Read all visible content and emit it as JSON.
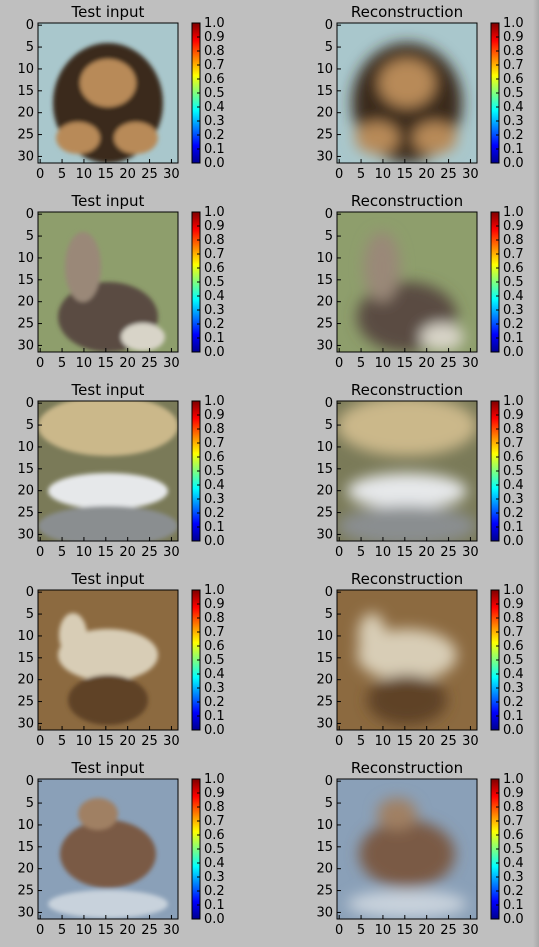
{
  "chart_data": [
    {
      "type": "heatmap",
      "title": "Test input",
      "image": "dog",
      "xticks": [
        0,
        5,
        10,
        15,
        20,
        25,
        30
      ],
      "yticks": [
        0,
        5,
        10,
        15,
        20,
        25,
        30
      ],
      "colorbar": {
        "ticks": [
          "0.0",
          "0.1",
          "0.2",
          "0.3",
          "0.4",
          "0.5",
          "0.6",
          "0.7",
          "0.8",
          "0.9",
          "1.0"
        ],
        "range": [
          0,
          1
        ],
        "colormap": "jet"
      }
    },
    {
      "type": "heatmap",
      "title": "Reconstruction",
      "image": "dog (blurred)",
      "xticks": [
        0,
        5,
        10,
        15,
        20,
        25,
        30
      ],
      "yticks": [
        0,
        5,
        10,
        15,
        20,
        25,
        30
      ],
      "colorbar": {
        "ticks": [
          "0.0",
          "0.1",
          "0.2",
          "0.3",
          "0.4",
          "0.5",
          "0.6",
          "0.7",
          "0.8",
          "0.9",
          "1.0"
        ],
        "range": [
          0,
          1
        ],
        "colormap": "jet"
      }
    },
    {
      "type": "heatmap",
      "title": "Test input",
      "image": "deer",
      "xticks": [
        0,
        5,
        10,
        15,
        20,
        25,
        30
      ],
      "yticks": [
        0,
        5,
        10,
        15,
        20,
        25,
        30
      ],
      "colorbar": {
        "ticks": [
          "0.0",
          "0.1",
          "0.2",
          "0.3",
          "0.4",
          "0.5",
          "0.6",
          "0.7",
          "0.8",
          "0.9",
          "1.0"
        ],
        "range": [
          0,
          1
        ],
        "colormap": "jet"
      }
    },
    {
      "type": "heatmap",
      "title": "Reconstruction",
      "image": "deer (blurred)",
      "xticks": [
        0,
        5,
        10,
        15,
        20,
        25,
        30
      ],
      "yticks": [
        0,
        5,
        10,
        15,
        20,
        25,
        30
      ],
      "colorbar": {
        "ticks": [
          "0.0",
          "0.1",
          "0.2",
          "0.3",
          "0.4",
          "0.5",
          "0.6",
          "0.7",
          "0.8",
          "0.9",
          "1.0"
        ],
        "range": [
          0,
          1
        ],
        "colormap": "jet"
      }
    },
    {
      "type": "heatmap",
      "title": "Test input",
      "image": "boat",
      "xticks": [
        0,
        5,
        10,
        15,
        20,
        25,
        30
      ],
      "yticks": [
        0,
        5,
        10,
        15,
        20,
        25,
        30
      ],
      "colorbar": {
        "ticks": [
          "0.0",
          "0.1",
          "0.2",
          "0.3",
          "0.4",
          "0.5",
          "0.6",
          "0.7",
          "0.8",
          "0.9",
          "1.0"
        ],
        "range": [
          0,
          1
        ],
        "colormap": "jet"
      }
    },
    {
      "type": "heatmap",
      "title": "Reconstruction",
      "image": "boat (blurred)",
      "xticks": [
        0,
        5,
        10,
        15,
        20,
        25,
        30
      ],
      "yticks": [
        0,
        5,
        10,
        15,
        20,
        25,
        30
      ],
      "colorbar": {
        "ticks": [
          "0.0",
          "0.1",
          "0.2",
          "0.3",
          "0.4",
          "0.5",
          "0.6",
          "0.7",
          "0.8",
          "0.9",
          "1.0"
        ],
        "range": [
          0,
          1
        ],
        "colormap": "jet"
      }
    },
    {
      "type": "heatmap",
      "title": "Test input",
      "image": "horse",
      "xticks": [
        0,
        5,
        10,
        15,
        20,
        25,
        30
      ],
      "yticks": [
        0,
        5,
        10,
        15,
        20,
        25,
        30
      ],
      "colorbar": {
        "ticks": [
          "0.0",
          "0.1",
          "0.2",
          "0.3",
          "0.4",
          "0.5",
          "0.6",
          "0.7",
          "0.8",
          "0.9",
          "1.0"
        ],
        "range": [
          0,
          1
        ],
        "colormap": "jet"
      }
    },
    {
      "type": "heatmap",
      "title": "Reconstruction",
      "image": "horse (blurred)",
      "xticks": [
        0,
        5,
        10,
        15,
        20,
        25,
        30
      ],
      "yticks": [
        0,
        5,
        10,
        15,
        20,
        25,
        30
      ],
      "colorbar": {
        "ticks": [
          "0.0",
          "0.1",
          "0.2",
          "0.3",
          "0.4",
          "0.5",
          "0.6",
          "0.7",
          "0.8",
          "0.9",
          "1.0"
        ],
        "range": [
          0,
          1
        ],
        "colormap": "jet"
      }
    },
    {
      "type": "heatmap",
      "title": "Test input",
      "image": "deer",
      "xticks": [
        0,
        5,
        10,
        15,
        20,
        25,
        30
      ],
      "yticks": [
        0,
        5,
        10,
        15,
        20,
        25,
        30
      ],
      "colorbar": {
        "ticks": [
          "0.0",
          "0.1",
          "0.2",
          "0.3",
          "0.4",
          "0.5",
          "0.6",
          "0.7",
          "0.8",
          "0.9",
          "1.0"
        ],
        "range": [
          0,
          1
        ],
        "colormap": "jet"
      }
    },
    {
      "type": "heatmap",
      "title": "Reconstruction",
      "image": "deer (blurred)",
      "xticks": [
        0,
        5,
        10,
        15,
        20,
        25,
        30
      ],
      "yticks": [
        0,
        5,
        10,
        15,
        20,
        25,
        30
      ],
      "colorbar": {
        "ticks": [
          "0.0",
          "0.1",
          "0.2",
          "0.3",
          "0.4",
          "0.5",
          "0.6",
          "0.7",
          "0.8",
          "0.9",
          "1.0"
        ],
        "range": [
          0,
          1
        ],
        "colormap": "jet"
      }
    }
  ],
  "palettes": {
    "dog": {
      "bg": "#a9c7cc",
      "main": "#3a2a1c",
      "accent": "#b88a58",
      "light": "#e2d8c6"
    },
    "deer": {
      "bg": "#8e9e6c",
      "main": "#5a4c42",
      "accent": "#9a8878",
      "light": "#d8d4c8"
    },
    "boat": {
      "bg": "#7a7a58",
      "main": "#e6e8ea",
      "accent": "#cbb88a",
      "light": "#f4f4f4"
    },
    "horse": {
      "bg": "#8c6a40",
      "main": "#d8cdb6",
      "accent": "#5e4226",
      "light": "#ece4d2"
    },
    "deer2": {
      "bg": "#8aa0b8",
      "main": "#7a5a44",
      "accent": "#a08064",
      "light": "#c8d2dc"
    }
  }
}
